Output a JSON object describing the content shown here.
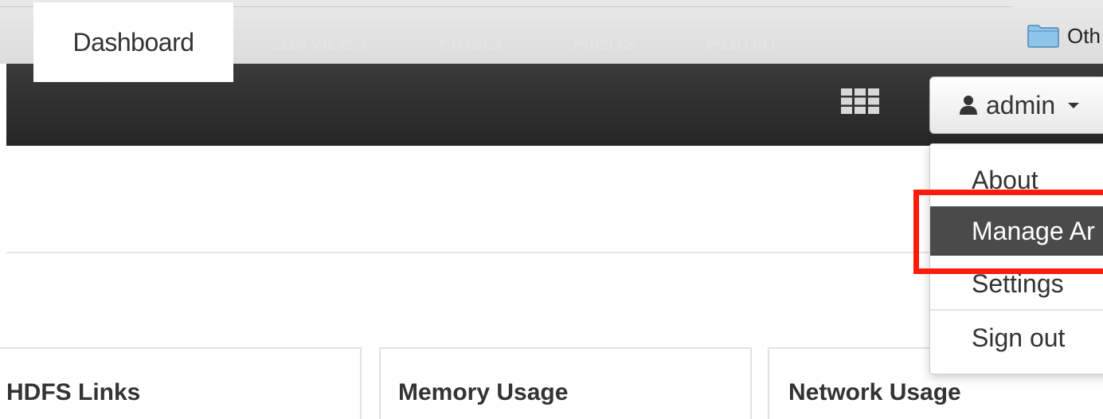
{
  "bookmarks": {
    "other_label": "Oth",
    "folder_icon": "folder-icon"
  },
  "navbar": {
    "tabs": [
      {
        "label": "Dashboard",
        "active": true
      },
      {
        "label": "Services",
        "active": false
      },
      {
        "label": "Hosts",
        "active": false
      },
      {
        "label": "Alerts",
        "active": false
      },
      {
        "label": "Admin",
        "active": false
      }
    ],
    "apps_icon": "grid-icon",
    "user": {
      "icon": "user-icon",
      "name": "admin"
    }
  },
  "user_menu": {
    "items": [
      {
        "label": "About"
      },
      {
        "label": "Manage Ar",
        "highlighted": true
      },
      {
        "label": "Settings"
      },
      {
        "label": "Sign out"
      }
    ]
  },
  "widgets": [
    {
      "title": "HDFS Links"
    },
    {
      "title": "Memory Usage"
    },
    {
      "title": "Network Usage"
    }
  ],
  "colors": {
    "navbar": "#2e2e2e",
    "highlight": "#4a4a4a",
    "annotation": "#ff1a0a"
  }
}
